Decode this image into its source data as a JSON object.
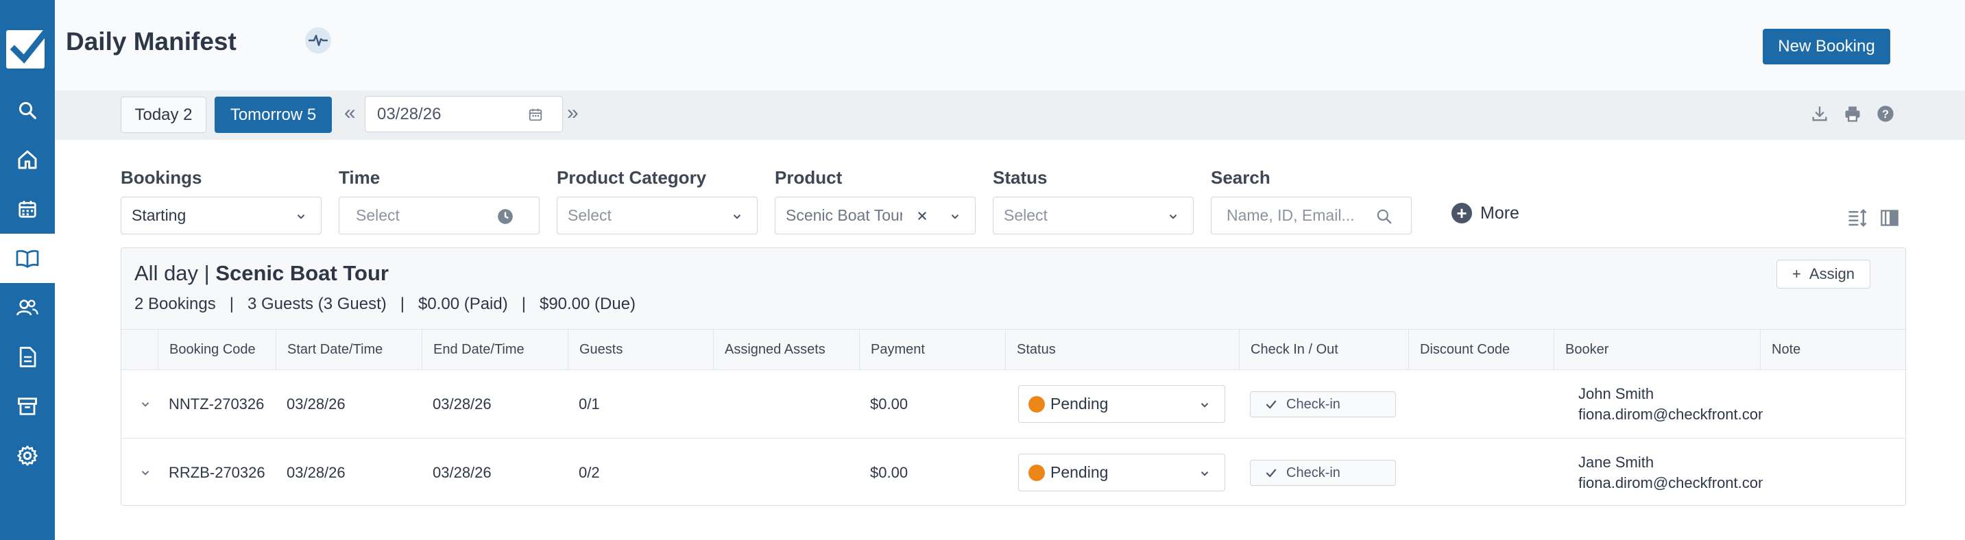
{
  "sidebar": {
    "items": [
      {
        "icon": "search-icon",
        "active": false
      },
      {
        "icon": "home-icon",
        "active": false
      },
      {
        "icon": "calendar-icon",
        "active": false
      },
      {
        "icon": "book-icon",
        "active": true
      },
      {
        "icon": "users-icon",
        "active": false
      },
      {
        "icon": "document-icon",
        "active": false
      },
      {
        "icon": "archive-icon",
        "active": false
      },
      {
        "icon": "gear-icon",
        "active": false
      }
    ]
  },
  "header": {
    "title": "Daily Manifest",
    "new_booking_label": "New Booking"
  },
  "toolbar": {
    "today_label": "Today 2",
    "tomorrow_label": "Tomorrow 5",
    "date_value": "03/28/26"
  },
  "filters": {
    "bookings": {
      "label": "Bookings",
      "value": "Starting"
    },
    "time": {
      "label": "Time",
      "placeholder": "Select"
    },
    "product_category": {
      "label": "Product Category",
      "placeholder": "Select"
    },
    "product": {
      "label": "Product",
      "value": "Scenic Boat Tour"
    },
    "status": {
      "label": "Status",
      "placeholder": "Select"
    },
    "search": {
      "label": "Search",
      "placeholder": "Name, ID, Email..."
    },
    "more_label": "More"
  },
  "group": {
    "prefix": "All day | ",
    "product": "Scenic Boat Tour",
    "summary": "2 Bookings   |   3 Guests (3 Guest)   |   $0.00 (Paid)   |   $90.00 (Due)",
    "assign_label": "Assign"
  },
  "table": {
    "columns": [
      "Booking Code",
      "Start Date/Time",
      "End Date/Time",
      "Guests",
      "Assigned Assets",
      "Payment",
      "Status",
      "Check In / Out",
      "Discount Code",
      "Booker",
      "Note"
    ],
    "rows": [
      {
        "code": "NNTZ-270326",
        "start": "03/28/26",
        "end": "03/28/26",
        "guests": "0/1",
        "assets": "",
        "payment": "$0.00",
        "status": "Pending",
        "checkin": "Check-in",
        "discount": "",
        "booker_name": "John Smith",
        "booker_email": "fiona.dirom@checkfront.com",
        "note": ""
      },
      {
        "code": "RRZB-270326",
        "start": "03/28/26",
        "end": "03/28/26",
        "guests": "0/2",
        "assets": "",
        "payment": "$0.00",
        "status": "Pending",
        "checkin": "Check-in",
        "discount": "",
        "booker_name": "Jane Smith",
        "booker_email": "fiona.dirom@checkfront.com",
        "note": ""
      }
    ]
  },
  "colors": {
    "accent": "#1d6aa8",
    "pending": "#ed8618"
  }
}
